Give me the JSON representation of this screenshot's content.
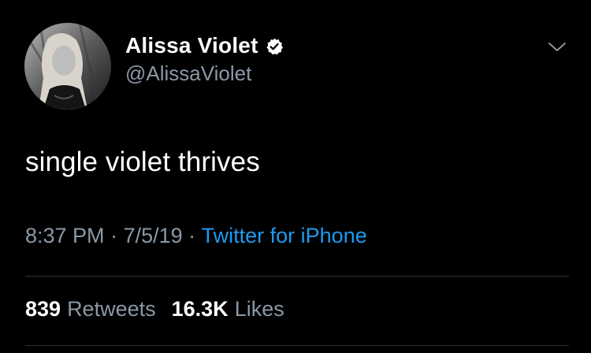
{
  "user": {
    "display_name": "Alissa Violet",
    "handle": "@AlissaViolet",
    "verified_icon": "verified-badge-icon",
    "avatar_icon": "profile-photo"
  },
  "header": {
    "menu_icon": "chevron-down-icon"
  },
  "tweet": {
    "text": "single violet thrives",
    "time": "8:37 PM",
    "separator": " · ",
    "date": "7/5/19",
    "source": "Twitter for iPhone"
  },
  "stats": {
    "retweets_count": "839",
    "retweets_label": "Retweets",
    "likes_count": "16.3K",
    "likes_label": "Likes"
  },
  "colors": {
    "background": "#000000",
    "primary_text": "#ffffff",
    "secondary_text": "#8b98a5",
    "link": "#1d9bf0",
    "divider": "#2f3336"
  }
}
